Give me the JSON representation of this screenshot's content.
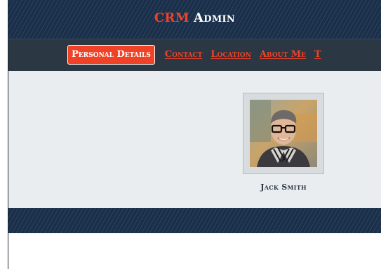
{
  "header": {
    "brand_crm": "CRM",
    "brand_admin": "Admin"
  },
  "nav": {
    "items": [
      {
        "label": "Personal Details",
        "active": true
      },
      {
        "label": "Contact",
        "active": false
      },
      {
        "label": "Location",
        "active": false
      },
      {
        "label": "About Me",
        "active": false
      },
      {
        "label": "T",
        "active": false
      }
    ]
  },
  "profile": {
    "name": "Jack Smith",
    "avatar_icon": "profile-photo"
  },
  "colors": {
    "accent": "#ef4227",
    "header_dark": "#1a2f4a",
    "nav_bg": "#2b3743",
    "panel_bg": "#e9edf0"
  }
}
